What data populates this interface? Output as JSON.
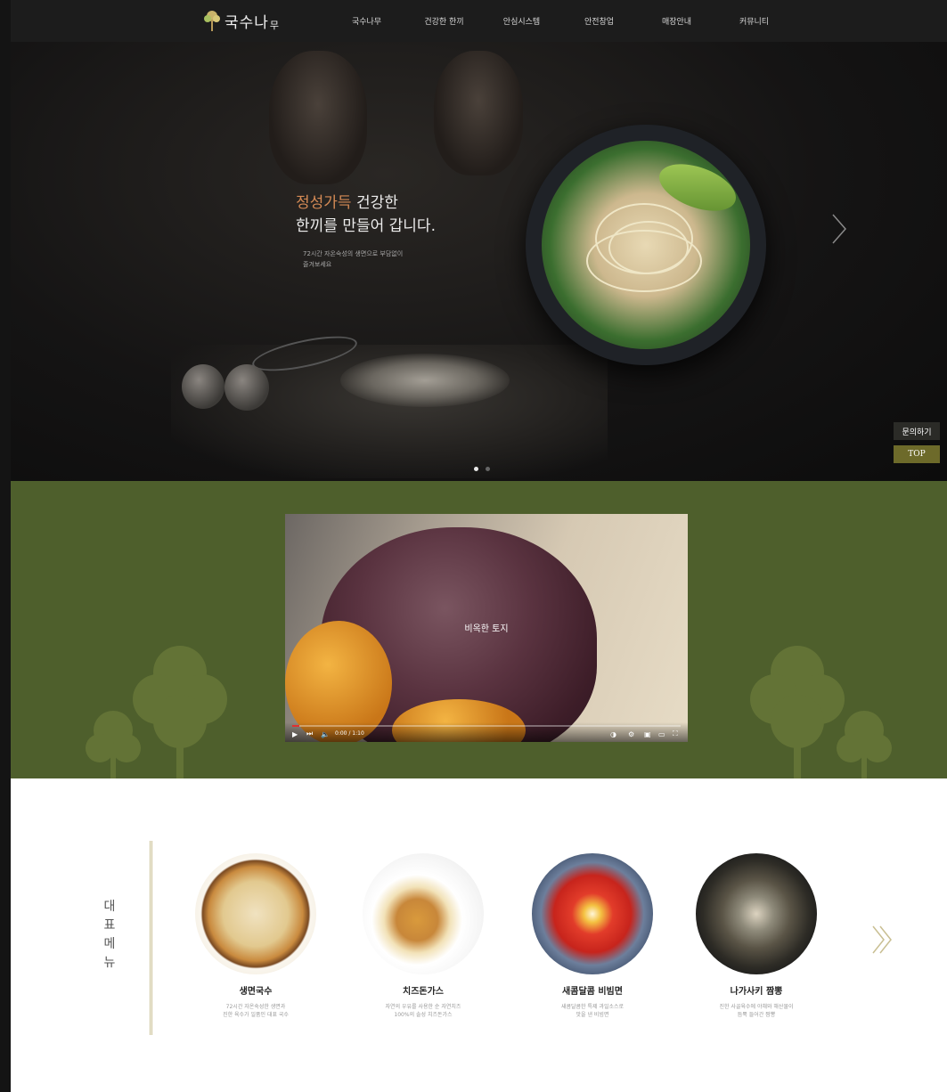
{
  "nav": {
    "logo_text": "국수나",
    "logo_sub": "무",
    "items": [
      "국수나무",
      "건강한 한끼",
      "안심시스템",
      "안전창업",
      "매장안내",
      "커뮤니티"
    ]
  },
  "hero": {
    "headline_accent": "정성가득",
    "headline_rest": " 건강한",
    "headline_line2": "한끼를 만들어 갑니다.",
    "sub_line1": "72시간 자온숙성의 생면으로 부담없이",
    "sub_line2": "즐겨보세요"
  },
  "side_buttons": {
    "inquiry": "문의하기",
    "top": "TOP"
  },
  "video": {
    "caption": "비옥한 토지",
    "time": "0:00 / 1:10"
  },
  "menu_section": {
    "title": "대표메뉴",
    "items": [
      {
        "name": "생면국수",
        "desc_line1": "72시간 자온숙성한 생면과",
        "desc_line2": "진한 육수가 일품인 대표 국수"
      },
      {
        "name": "치즈돈가스",
        "desc_line1": "자연의 우유를 사용한 순 자연치즈",
        "desc_line2": "100%의 솔성 치즈돈가스"
      },
      {
        "name": "새콤달콤 비빔면",
        "desc_line1": "새콤달콤한 특제 과일소스로",
        "desc_line2": "맛을 낸 비빔면"
      },
      {
        "name": "나가사키 짬뽕",
        "desc_line1": "진한 사골육수에 야채와 해산물이",
        "desc_line2": "듬뿍 들어간 짬뽕"
      }
    ]
  },
  "colors": {
    "accent": "#d48a55",
    "olive": "#4e5f2c",
    "top_button": "#6d6a2a"
  }
}
